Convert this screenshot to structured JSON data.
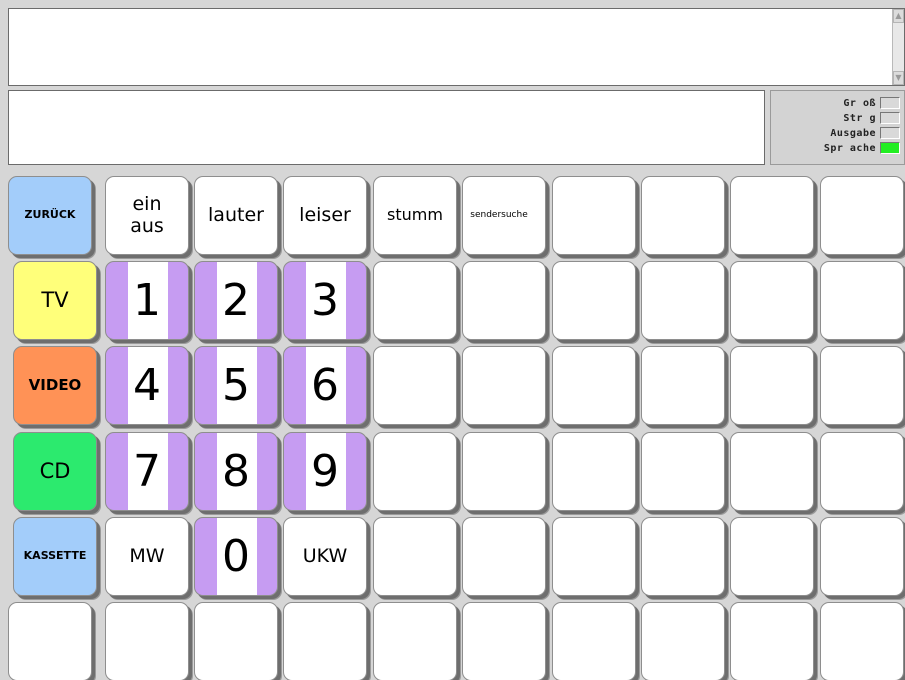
{
  "output": {
    "text": ""
  },
  "message": {
    "text": ""
  },
  "status": [
    {
      "label": "Gr oß",
      "color": "#d9d9d9",
      "on": false
    },
    {
      "label": "Str g",
      "color": "#d9d9d9",
      "on": false
    },
    {
      "label": "Ausgabe",
      "color": "#d9d9d9",
      "on": false
    },
    {
      "label": "Spr ache",
      "color": "#22ee22",
      "on": true
    }
  ],
  "colors": {
    "zuruck": "#a3cdfa",
    "tv": "#ffff7a",
    "video": "#ff9256",
    "cd": "#2cea6e",
    "kassette": "#a3cdfa",
    "digit": "#c69cf2"
  },
  "keys": {
    "zuruck": "ZURÜCK",
    "ein_aus": "ein\naus",
    "lauter": "lauter",
    "leiser": "leiser",
    "stumm": "stumm",
    "sendersuche": "sendersuche",
    "tv": "TV",
    "video": "VIDEO",
    "cd": "CD",
    "kassette": "KASSETTE",
    "mw": "MW",
    "ukw": "UKW",
    "d1": "1",
    "d2": "2",
    "d3": "3",
    "d4": "4",
    "d5": "5",
    "d6": "6",
    "d7": "7",
    "d8": "8",
    "d9": "9",
    "d0": "0"
  }
}
